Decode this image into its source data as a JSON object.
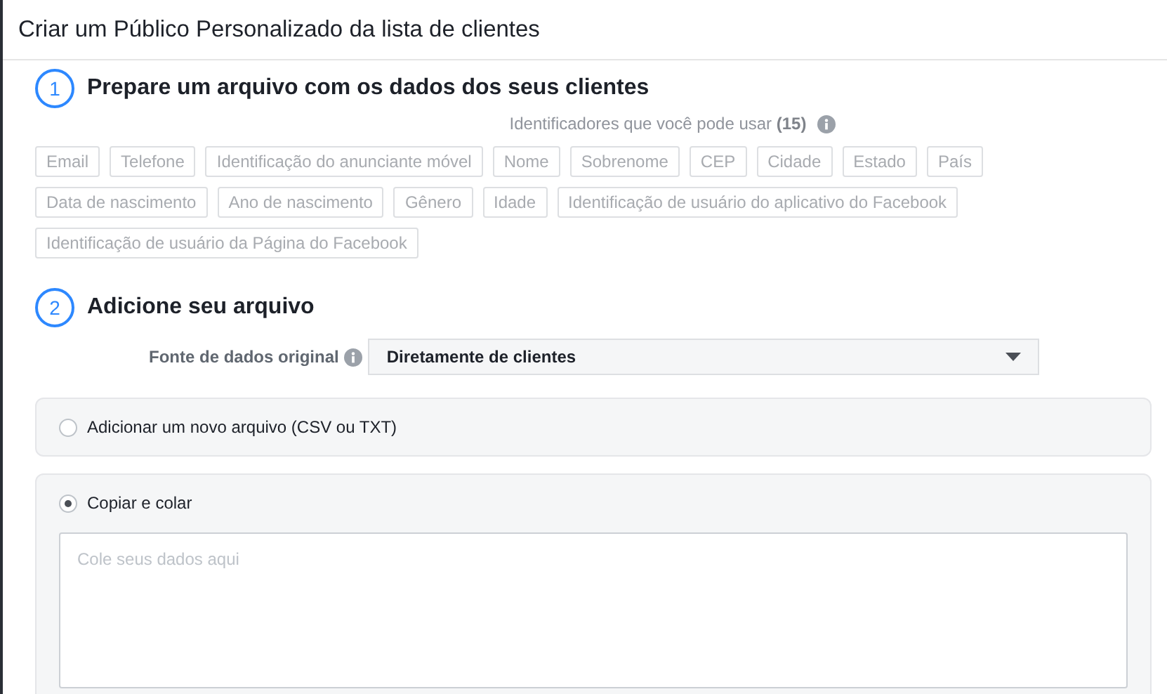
{
  "window": {
    "title": "Criar um Público Personalizado da lista de clientes"
  },
  "step1": {
    "number": "1",
    "title": "Prepare um arquivo com os dados dos seus clientes",
    "hint": "Identificadores que você pode usar **(15)**",
    "identifiers": [
      [
        "Email",
        "Telefone",
        "Identificação do anunciante móvel",
        "Nome",
        "Sobrenome",
        "CEP",
        "Cidade",
        "Estado",
        "País"
      ],
      [
        "Data de nascimento",
        "Ano de nascimento",
        "Gênero",
        "Idade",
        "Identificação de usuário do aplicativo do Facebook"
      ],
      [
        "Identificação de usuário da Página do Facebook"
      ]
    ]
  },
  "step2": {
    "number": "2",
    "title": "Adicione seu arquivo",
    "source_label": "Fonte de dados original",
    "source_value": "Diretamente de clientes"
  },
  "options": [
    {
      "label": "Adicionar um novo arquivo (CSV ou TXT)",
      "selected": false
    },
    {
      "label": "Copiar e colar",
      "selected": true,
      "placeholder": "Cole seus dados aqui"
    }
  ]
}
